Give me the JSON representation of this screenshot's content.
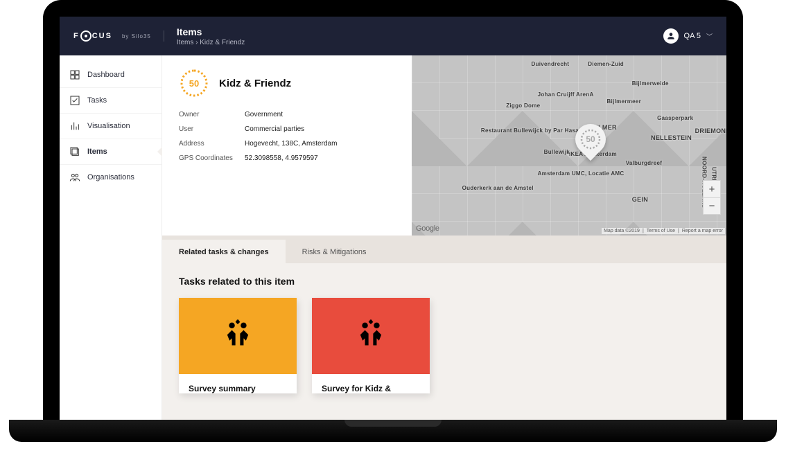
{
  "brand": {
    "by": "by Silo35"
  },
  "header": {
    "title": "Items",
    "breadcrumb": "Items › Kidz & Friendz",
    "user": "QA 5"
  },
  "sidebar": {
    "items": [
      {
        "label": "Dashboard"
      },
      {
        "label": "Tasks"
      },
      {
        "label": "Visualisation"
      },
      {
        "label": "Items"
      },
      {
        "label": "Organisations"
      }
    ],
    "active_index": 3
  },
  "item": {
    "score": "50",
    "title": "Kidz & Friendz",
    "fields": {
      "owner": {
        "label": "Owner",
        "value": "Government"
      },
      "user": {
        "label": "User",
        "value": "Commercial parties"
      },
      "address": {
        "label": "Address",
        "value": "Hogevecht, 138C, Amsterdam"
      },
      "gps": {
        "label": "GPS Coordinates",
        "value": "52.3098558, 4.9579597"
      }
    }
  },
  "map": {
    "pin_score": "50",
    "provider": "Google",
    "attribution": [
      "Map data ©2019",
      "Terms of Use",
      "Report a map error"
    ],
    "labels": [
      "Duivendrecht",
      "Diemen-Zuid",
      "Bijlmerweide",
      "Bijlmermeer",
      "BIJLMER",
      "NELLESTEIN",
      "Gaasperpark",
      "DRIEMOND",
      "GEIN",
      "Ouderkerk aan de Amstel",
      "IKEA Amsterdam",
      "Ziggo Dome",
      "Johan Cruijff ArenA",
      "Amsterdam UMC, Locatie AMC",
      "Restaurant Bullewijck by Par Hasard",
      "Bullewijk",
      "NOORD-HOLLAND",
      "UTRECHT",
      "Valburgdreef"
    ]
  },
  "tabs": {
    "items": [
      {
        "label": "Related tasks & changes"
      },
      {
        "label": "Risks & Mitigations"
      }
    ],
    "active_index": 0,
    "section_title": "Tasks related to this item",
    "cards": [
      {
        "color": "orange",
        "label": "Survey summary"
      },
      {
        "color": "red",
        "label": "Survey for Kidz &"
      }
    ]
  }
}
